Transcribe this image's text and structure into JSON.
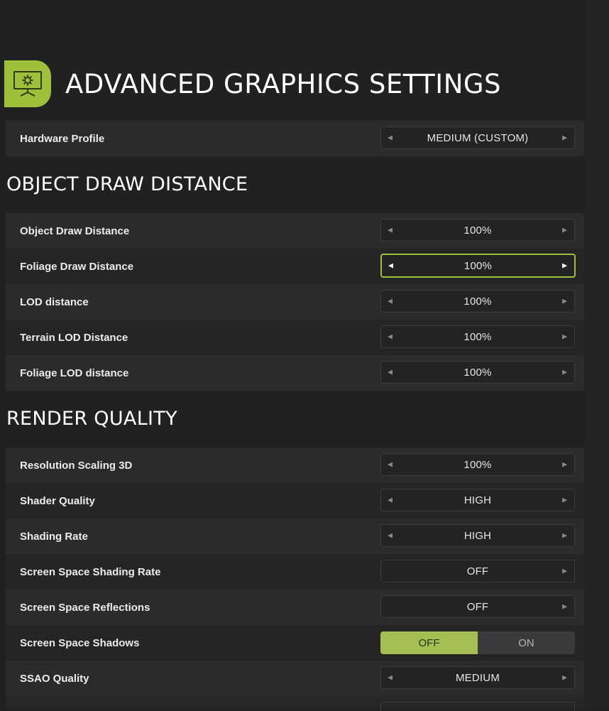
{
  "title": "ADVANCED GRAPHICS SETTINGS",
  "header_icon": "monitor-gear-icon",
  "accent_color": "#9fc03a",
  "hardware_profile": {
    "label": "Hardware Profile",
    "value": "MEDIUM (CUSTOM)"
  },
  "sections": {
    "object_draw_distance": {
      "title": "OBJECT DRAW DISTANCE",
      "rows": [
        {
          "label": "Object Draw Distance",
          "value": "100%"
        },
        {
          "label": "Foliage Draw Distance",
          "value": "100%"
        },
        {
          "label": "LOD distance",
          "value": "100%"
        },
        {
          "label": "Terrain LOD Distance",
          "value": "100%"
        },
        {
          "label": "Foliage LOD distance",
          "value": "100%"
        }
      ]
    },
    "render_quality": {
      "title": "RENDER QUALITY",
      "rows": [
        {
          "label": "Resolution Scaling 3D",
          "value": "100%"
        },
        {
          "label": "Shader Quality",
          "value": "HIGH"
        },
        {
          "label": "Shading Rate",
          "value": "HIGH"
        },
        {
          "label": "Screen Space Shading Rate",
          "value": "OFF"
        },
        {
          "label": "Screen Space Reflections",
          "value": "OFF"
        },
        {
          "label": "Screen Space Shadows",
          "off": "OFF",
          "on": "ON",
          "selected": "OFF"
        },
        {
          "label": "SSAO Quality",
          "value": "MEDIUM"
        }
      ]
    }
  }
}
